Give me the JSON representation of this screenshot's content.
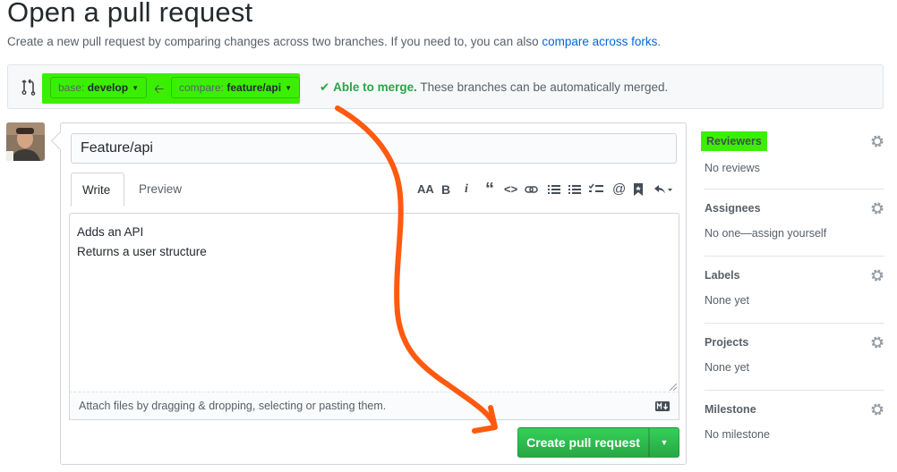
{
  "page": {
    "title": "Open a pull request",
    "subtitle_prefix": "Create a new pull request by comparing changes across two branches. If you need to, you can also ",
    "subtitle_link": "compare across forks",
    "subtitle_suffix": "."
  },
  "range": {
    "base_key": "base:",
    "base_value": "develop",
    "compare_key": "compare:",
    "compare_value": "feature/api",
    "merge_status": "Able to merge.",
    "merge_note": " These branches can be automatically merged."
  },
  "form": {
    "title_value": "Feature/api",
    "tabs": [
      "Write",
      "Preview"
    ],
    "toolbar": {
      "heading": "AA",
      "bold": "B",
      "italic": "i",
      "mention": "@"
    },
    "body_lines": [
      "Adds an API",
      "Returns a user structure"
    ],
    "attach_hint": "Attach files by dragging & dropping, selecting or pasting them.",
    "submit_label": "Create pull request"
  },
  "sidebar": [
    {
      "heading": "Reviewers",
      "value": "No reviews"
    },
    {
      "heading": "Assignees",
      "value": "No one—assign yourself"
    },
    {
      "heading": "Labels",
      "value": "None yet"
    },
    {
      "heading": "Projects",
      "value": "None yet"
    },
    {
      "heading": "Milestone",
      "value": "No milestone"
    }
  ],
  "colors": {
    "highlight": "#3af000",
    "annotation_arrow": "#ff5a0f",
    "link": "#0366d6",
    "success": "#28a745"
  }
}
